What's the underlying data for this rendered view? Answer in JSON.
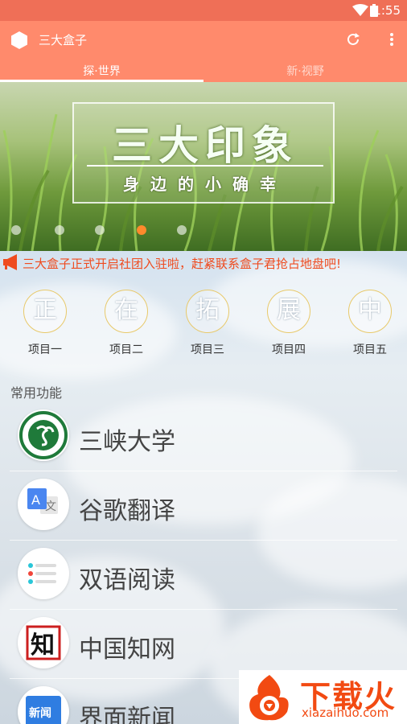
{
  "status_bar": {
    "time": "1:55"
  },
  "app_bar": {
    "title": "三大盒子"
  },
  "tabs": [
    {
      "label": "探·世界",
      "active": true
    },
    {
      "label": "新·视野",
      "active": false
    }
  ],
  "banner": {
    "title": "三大印象",
    "subtitle": "身边的小确幸",
    "active_slide": 4,
    "slide_count": 5
  },
  "notice": {
    "text": "三大盒子正式开启社团入驻啦，赶紧联系盒子君抢占地盘吧!"
  },
  "projects": [
    {
      "char": "正",
      "label": "项目一"
    },
    {
      "char": "在",
      "label": "项目二"
    },
    {
      "char": "拓",
      "label": "项目三"
    },
    {
      "char": "展",
      "label": "项目四"
    },
    {
      "char": "中",
      "label": "项目五"
    }
  ],
  "section_title": "常用功能",
  "functions": [
    {
      "name": "三峡大学",
      "icon": "university-logo-icon"
    },
    {
      "name": "谷歌翻译",
      "icon": "google-translate-icon"
    },
    {
      "name": "双语阅读",
      "icon": "list-icon"
    },
    {
      "name": "中国知网",
      "icon": "cnki-icon",
      "icon_text": "知"
    },
    {
      "name": "界面新闻",
      "icon": "news-icon",
      "icon_text": "新闻"
    }
  ],
  "watermark": {
    "title": "下载火",
    "url": "xiazaihuo.com"
  },
  "colors": {
    "primary": "#ff8a6c",
    "status_bar": "#ef6f57",
    "notice": "#ef4b1f",
    "accent": "#ff8a2c"
  }
}
